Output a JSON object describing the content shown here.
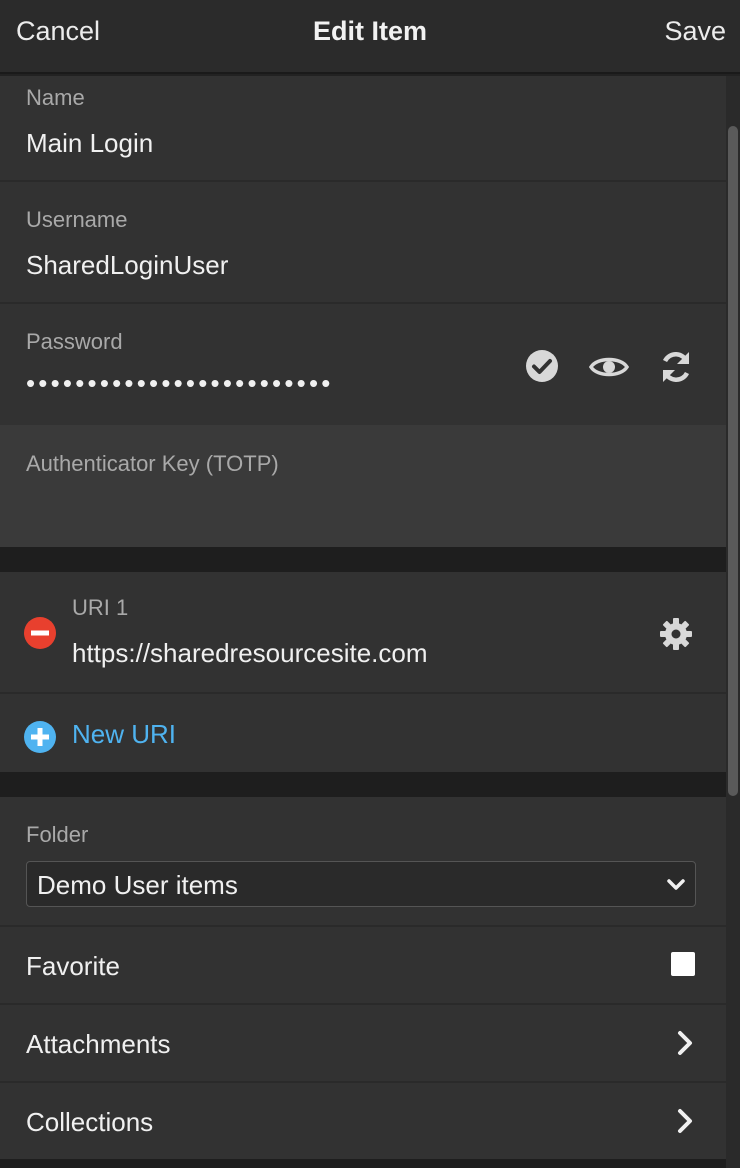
{
  "header": {
    "cancel": "Cancel",
    "title": "Edit Item",
    "save": "Save"
  },
  "login": {
    "name_label": "Name",
    "name_value": "Main Login",
    "username_label": "Username",
    "username_value": "SharedLoginUser",
    "password_label": "Password",
    "password_value": "•••••••••••••••••••••••••",
    "totp_label": "Authenticator Key (TOTP)",
    "totp_value": ""
  },
  "uris": {
    "items": [
      {
        "label": "URI 1",
        "value": "https://sharedresourcesite.com"
      }
    ],
    "new_label": "New URI"
  },
  "options": {
    "folder_label": "Folder",
    "folder_value": "Demo User items",
    "favorite_label": "Favorite",
    "favorite_checked": false,
    "attachments_label": "Attachments",
    "collections_label": "Collections"
  },
  "colors": {
    "accent": "#4fb3f0",
    "remove": "#e8402e",
    "background": "#323232"
  },
  "icons": [
    "check-circle-icon",
    "eye-icon",
    "refresh-icon",
    "remove-icon",
    "gear-icon",
    "add-icon",
    "chevron-down-icon",
    "chevron-right-icon"
  ]
}
